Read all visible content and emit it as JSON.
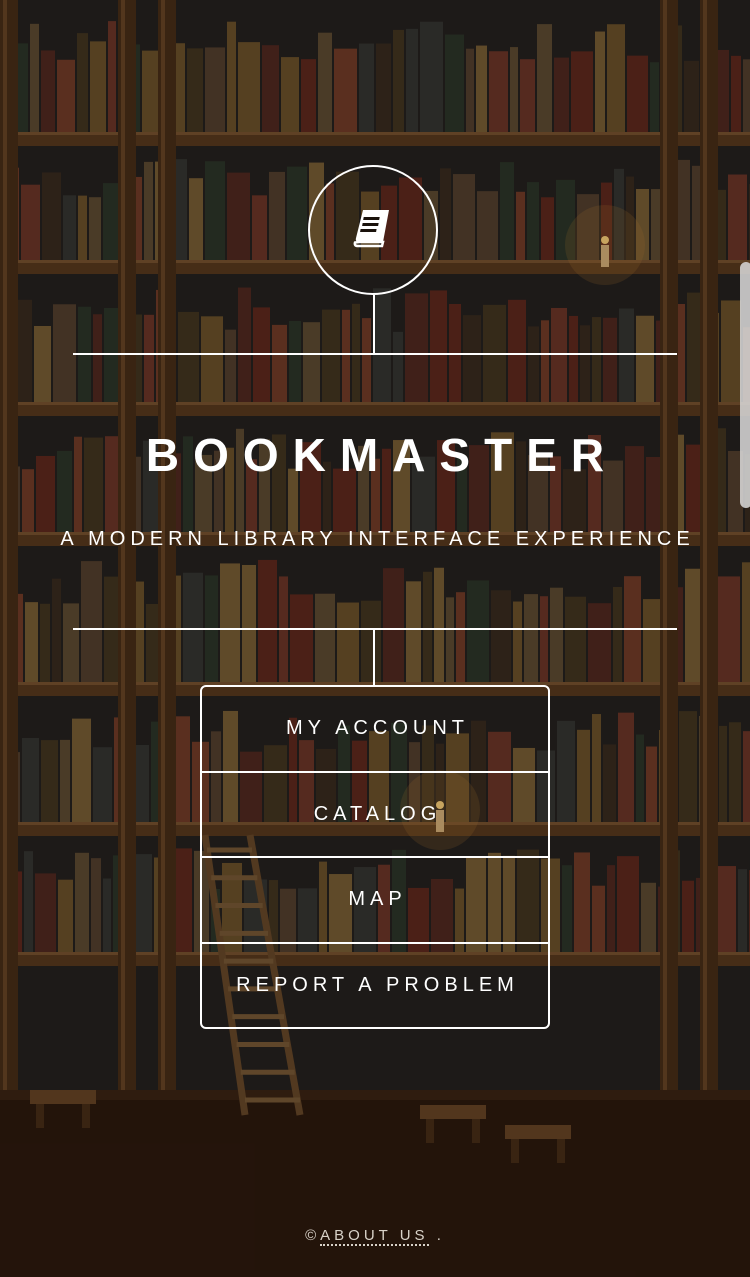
{
  "app": {
    "title": "BOOKMASTER",
    "subtitle": "A MODERN LIBRARY INTERFACE EXPERIENCE",
    "logo_icon": "book-icon"
  },
  "menu": {
    "items": [
      {
        "label": "MY ACCOUNT"
      },
      {
        "label": "CATALOG"
      },
      {
        "label": "MAP"
      },
      {
        "label": "REPORT A PROBLEM"
      }
    ]
  },
  "footer": {
    "copyright": "©",
    "about_label": "ABOUT US",
    "suffix": " ."
  },
  "colors": {
    "foreground": "#ffffff",
    "background": "#1a120c",
    "shelf_wood": "#5a3a1e",
    "stone": "#2a2624"
  }
}
